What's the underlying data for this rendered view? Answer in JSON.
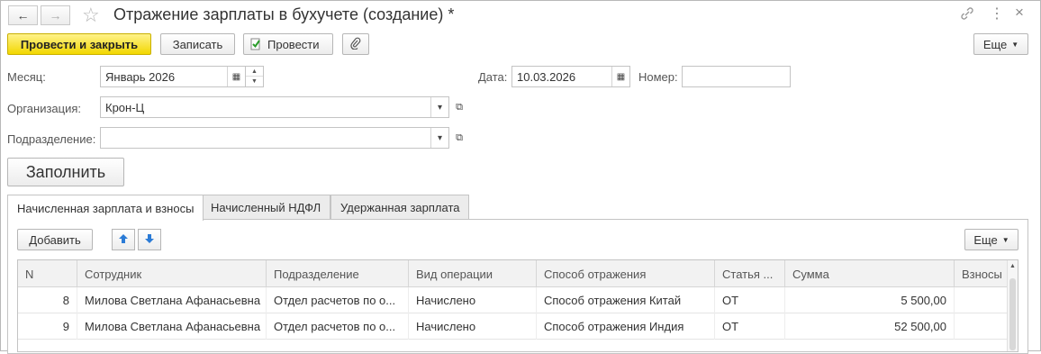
{
  "window": {
    "title": "Отражение зарплаты в бухучете (создание) *"
  },
  "toolbar": {
    "post_close": "Провести и закрыть",
    "save": "Записать",
    "post": "Провести",
    "more": "Еще"
  },
  "form": {
    "month_label": "Месяц:",
    "month_value": "Январь 2026",
    "date_label": "Дата:",
    "date_value": "10.03.2026",
    "number_label": "Номер:",
    "number_value": "",
    "org_label": "Организация:",
    "org_value": "Крон-Ц",
    "dept_label": "Подразделение:",
    "dept_value": "",
    "fill_button": "Заполнить"
  },
  "tabs": [
    {
      "label": "Начисленная зарплата и взносы",
      "active": true
    },
    {
      "label": "Начисленный НДФЛ",
      "active": false
    },
    {
      "label": "Удержанная зарплата",
      "active": false
    }
  ],
  "table_toolbar": {
    "add": "Добавить",
    "more": "Еще"
  },
  "table": {
    "columns": [
      "N",
      "Сотрудник",
      "Подразделение",
      "Вид операции",
      "Способ отражения",
      "Статья ...",
      "Сумма",
      "Взносы"
    ],
    "rows": [
      {
        "n": "8",
        "employee": "Милова Светлана Афанасьевна",
        "dept": "Отдел расчетов по о...",
        "op": "Начислено",
        "method": "Способ отражения Китай",
        "article": "ОТ",
        "sum": "5 500,00",
        "contrib": ""
      },
      {
        "n": "9",
        "employee": "Милова Светлана Афанасьевна",
        "dept": "Отдел расчетов по о...",
        "op": "Начислено",
        "method": "Способ отражения Индия",
        "article": "ОТ",
        "sum": "52 500,00",
        "contrib": ""
      }
    ]
  },
  "colors": {
    "primary_button": "#f2d700",
    "border": "#c4c4c4",
    "header_bg": "#f2f2f2"
  }
}
